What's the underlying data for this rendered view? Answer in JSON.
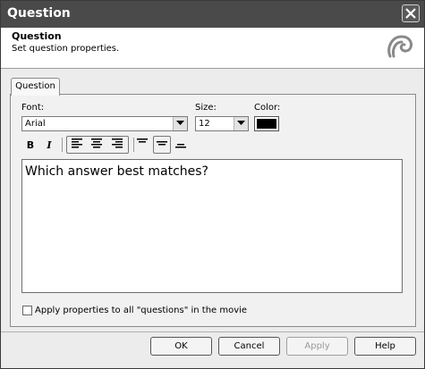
{
  "window": {
    "title": "Question",
    "close_icon": "close-icon"
  },
  "header": {
    "title": "Question",
    "subtitle": "Set question properties.",
    "logo_icon": "app-logo-icon"
  },
  "tabs": [
    {
      "label": "Question",
      "selected": true
    }
  ],
  "font": {
    "label": "Font:",
    "value": "Arial"
  },
  "size": {
    "label": "Size:",
    "value": "12"
  },
  "color": {
    "label": "Color:",
    "value": "#000000"
  },
  "toolbar": {
    "bold": "B",
    "italic": "I",
    "align_icons": [
      "align-left-icon",
      "align-center-icon",
      "align-right-icon"
    ],
    "valign_icons": [
      "align-top-icon",
      "align-middle-icon",
      "align-bottom-icon"
    ],
    "selected_align": "left",
    "selected_valign": "middle"
  },
  "text": "Which answer best matches?",
  "apply_all": {
    "label": "Apply properties to all \"questions\" in the movie",
    "checked": false
  },
  "buttons": {
    "ok": "OK",
    "cancel": "Cancel",
    "apply": "Apply",
    "help": "Help"
  }
}
